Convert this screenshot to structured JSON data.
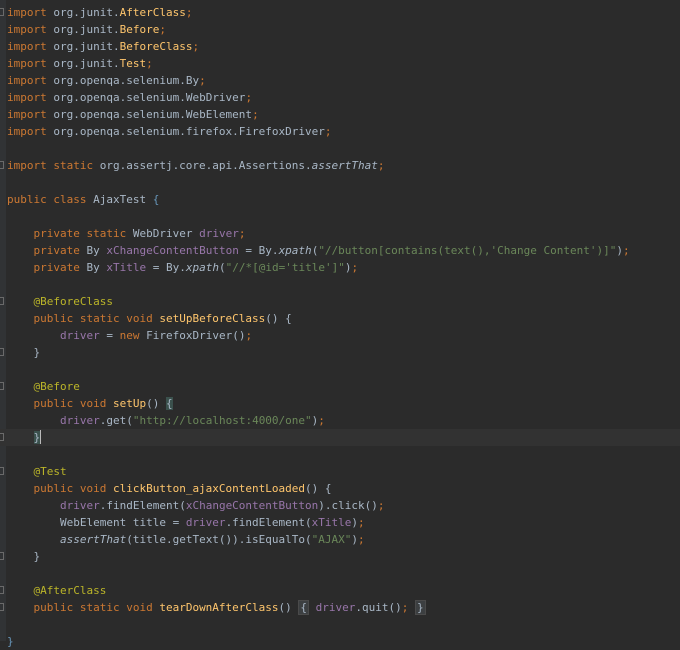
{
  "theme": {
    "background": "#2b2b2b",
    "keyword": "#cc7832",
    "plain": "#a9b7c6",
    "annotation": "#bbb529",
    "string": "#6a8759",
    "field": "#9876aa",
    "method": "#ffc66d",
    "current_line": "#323232"
  },
  "code": {
    "lines": [
      {
        "tokens": [
          {
            "t": "import",
            "c": "kw"
          },
          {
            "t": " org.junit.",
            "c": "pl"
          },
          {
            "t": "AfterClass",
            "c": "imp-cls"
          },
          {
            "t": ";",
            "c": "kw"
          }
        ],
        "fold": true
      },
      {
        "tokens": [
          {
            "t": "import",
            "c": "kw"
          },
          {
            "t": " org.junit.",
            "c": "pl"
          },
          {
            "t": "Before",
            "c": "imp-cls"
          },
          {
            "t": ";",
            "c": "kw"
          }
        ]
      },
      {
        "tokens": [
          {
            "t": "import",
            "c": "kw"
          },
          {
            "t": " org.junit.",
            "c": "pl"
          },
          {
            "t": "BeforeClass",
            "c": "imp-cls"
          },
          {
            "t": ";",
            "c": "kw"
          }
        ]
      },
      {
        "tokens": [
          {
            "t": "import",
            "c": "kw"
          },
          {
            "t": " org.junit.",
            "c": "pl"
          },
          {
            "t": "Test",
            "c": "imp-cls"
          },
          {
            "t": ";",
            "c": "kw"
          }
        ]
      },
      {
        "tokens": [
          {
            "t": "import",
            "c": "kw"
          },
          {
            "t": " org.openqa.selenium.By",
            "c": "pl"
          },
          {
            "t": ";",
            "c": "kw"
          }
        ]
      },
      {
        "tokens": [
          {
            "t": "import",
            "c": "kw"
          },
          {
            "t": " org.openqa.selenium.WebDriver",
            "c": "pl"
          },
          {
            "t": ";",
            "c": "kw"
          }
        ]
      },
      {
        "tokens": [
          {
            "t": "import",
            "c": "kw"
          },
          {
            "t": " org.openqa.selenium.WebElement",
            "c": "pl"
          },
          {
            "t": ";",
            "c": "kw"
          }
        ]
      },
      {
        "tokens": [
          {
            "t": "import",
            "c": "kw"
          },
          {
            "t": " org.openqa.selenium.firefox.FirefoxDriver",
            "c": "pl"
          },
          {
            "t": ";",
            "c": "kw"
          }
        ]
      },
      {
        "tokens": []
      },
      {
        "tokens": [
          {
            "t": "import static",
            "c": "kw"
          },
          {
            "t": " org.assertj.core.api.Assertions.",
            "c": "pl"
          },
          {
            "t": "assertThat",
            "c": "it"
          },
          {
            "t": ";",
            "c": "kw"
          }
        ],
        "fold": true
      },
      {
        "tokens": []
      },
      {
        "tokens": [
          {
            "t": "public class",
            "c": "kw"
          },
          {
            "t": " AjaxTest ",
            "c": "pl"
          },
          {
            "t": "{",
            "c": "bl"
          }
        ]
      },
      {
        "tokens": []
      },
      {
        "tokens": [
          {
            "t": "    private static",
            "c": "kw"
          },
          {
            "t": " WebDriver ",
            "c": "pl"
          },
          {
            "t": "driver",
            "c": "fd"
          },
          {
            "t": ";",
            "c": "kw"
          }
        ]
      },
      {
        "tokens": [
          {
            "t": "    private",
            "c": "kw"
          },
          {
            "t": " By ",
            "c": "pl"
          },
          {
            "t": "xChangeContentButton",
            "c": "fd"
          },
          {
            "t": " = By.",
            "c": "pl"
          },
          {
            "t": "xpath",
            "c": "it"
          },
          {
            "t": "(",
            "c": "pl"
          },
          {
            "t": "\"//button[contains(text(),'Change Content')]\"",
            "c": "st"
          },
          {
            "t": ")",
            "c": "pl"
          },
          {
            "t": ";",
            "c": "kw"
          }
        ]
      },
      {
        "tokens": [
          {
            "t": "    private",
            "c": "kw"
          },
          {
            "t": " By ",
            "c": "pl"
          },
          {
            "t": "xTitle",
            "c": "fd"
          },
          {
            "t": " = By.",
            "c": "pl"
          },
          {
            "t": "xpath",
            "c": "it"
          },
          {
            "t": "(",
            "c": "pl"
          },
          {
            "t": "\"//*[@id='title']\"",
            "c": "st"
          },
          {
            "t": ")",
            "c": "pl"
          },
          {
            "t": ";",
            "c": "kw"
          }
        ]
      },
      {
        "tokens": []
      },
      {
        "tokens": [
          {
            "t": "    @BeforeClass",
            "c": "an"
          }
        ],
        "fold": true
      },
      {
        "tokens": [
          {
            "t": "    public static void",
            "c": "kw"
          },
          {
            "t": " ",
            "c": "pl"
          },
          {
            "t": "setUpBeforeClass",
            "c": "fn"
          },
          {
            "t": "() {",
            "c": "pl"
          }
        ]
      },
      {
        "tokens": [
          {
            "t": "        ",
            "c": "pl"
          },
          {
            "t": "driver",
            "c": "fd"
          },
          {
            "t": " = ",
            "c": "pl"
          },
          {
            "t": "new",
            "c": "kw"
          },
          {
            "t": " FirefoxDriver()",
            "c": "pl"
          },
          {
            "t": ";",
            "c": "kw"
          }
        ]
      },
      {
        "tokens": [
          {
            "t": "    }",
            "c": "pl"
          }
        ],
        "fold": true
      },
      {
        "tokens": []
      },
      {
        "tokens": [
          {
            "t": "    @Before",
            "c": "an"
          }
        ],
        "fold": true
      },
      {
        "tokens": [
          {
            "t": "    public void",
            "c": "kw"
          },
          {
            "t": " ",
            "c": "pl"
          },
          {
            "t": "setUp",
            "c": "fn"
          },
          {
            "t": "() ",
            "c": "pl"
          },
          {
            "t": "{",
            "c": "br-hl"
          }
        ]
      },
      {
        "tokens": [
          {
            "t": "        ",
            "c": "pl"
          },
          {
            "t": "driver",
            "c": "fd"
          },
          {
            "t": ".get(",
            "c": "pl"
          },
          {
            "t": "\"http://localhost:4000/one\"",
            "c": "st"
          },
          {
            "t": ")",
            "c": "pl"
          },
          {
            "t": ";",
            "c": "kw"
          }
        ]
      },
      {
        "tokens": [
          {
            "t": "    ",
            "c": "pl"
          },
          {
            "t": "}",
            "c": "br-hl"
          }
        ],
        "current": true,
        "caret": true,
        "fold": true
      },
      {
        "tokens": []
      },
      {
        "tokens": [
          {
            "t": "    @Test",
            "c": "an"
          }
        ],
        "fold": true
      },
      {
        "tokens": [
          {
            "t": "    public void",
            "c": "kw"
          },
          {
            "t": " ",
            "c": "pl"
          },
          {
            "t": "clickButton_ajaxContentLoaded",
            "c": "fn"
          },
          {
            "t": "() {",
            "c": "pl"
          }
        ]
      },
      {
        "tokens": [
          {
            "t": "        ",
            "c": "pl"
          },
          {
            "t": "driver",
            "c": "fd"
          },
          {
            "t": ".findElement(",
            "c": "pl"
          },
          {
            "t": "xChangeContentButton",
            "c": "fd"
          },
          {
            "t": ").click()",
            "c": "pl"
          },
          {
            "t": ";",
            "c": "kw"
          }
        ]
      },
      {
        "tokens": [
          {
            "t": "        WebElement title = ",
            "c": "pl"
          },
          {
            "t": "driver",
            "c": "fd"
          },
          {
            "t": ".findElement(",
            "c": "pl"
          },
          {
            "t": "xTitle",
            "c": "fd"
          },
          {
            "t": ")",
            "c": "pl"
          },
          {
            "t": ";",
            "c": "kw"
          }
        ]
      },
      {
        "tokens": [
          {
            "t": "        ",
            "c": "pl"
          },
          {
            "t": "assertThat",
            "c": "it"
          },
          {
            "t": "(title.getText()).isEqualTo(",
            "c": "pl"
          },
          {
            "t": "\"AJAX\"",
            "c": "st"
          },
          {
            "t": ")",
            "c": "pl"
          },
          {
            "t": ";",
            "c": "kw"
          }
        ]
      },
      {
        "tokens": [
          {
            "t": "    }",
            "c": "pl"
          }
        ],
        "fold": true
      },
      {
        "tokens": []
      },
      {
        "tokens": [
          {
            "t": "    @AfterClass",
            "c": "an"
          }
        ],
        "fold": true
      },
      {
        "tokens": [
          {
            "t": "    public static void",
            "c": "kw"
          },
          {
            "t": " ",
            "c": "pl"
          },
          {
            "t": "tearDownAfterClass",
            "c": "fn"
          },
          {
            "t": "() ",
            "c": "pl"
          },
          {
            "t": "{",
            "c": "br-bx"
          },
          {
            "t": " ",
            "c": "pl"
          },
          {
            "t": "driver",
            "c": "fd"
          },
          {
            "t": ".quit()",
            "c": "pl"
          },
          {
            "t": ";",
            "c": "kw"
          },
          {
            "t": " ",
            "c": "pl"
          },
          {
            "t": "}",
            "c": "br-bx"
          }
        ],
        "fold": true
      },
      {
        "tokens": []
      },
      {
        "tokens": [
          {
            "t": "}",
            "c": "bl"
          }
        ]
      }
    ]
  }
}
